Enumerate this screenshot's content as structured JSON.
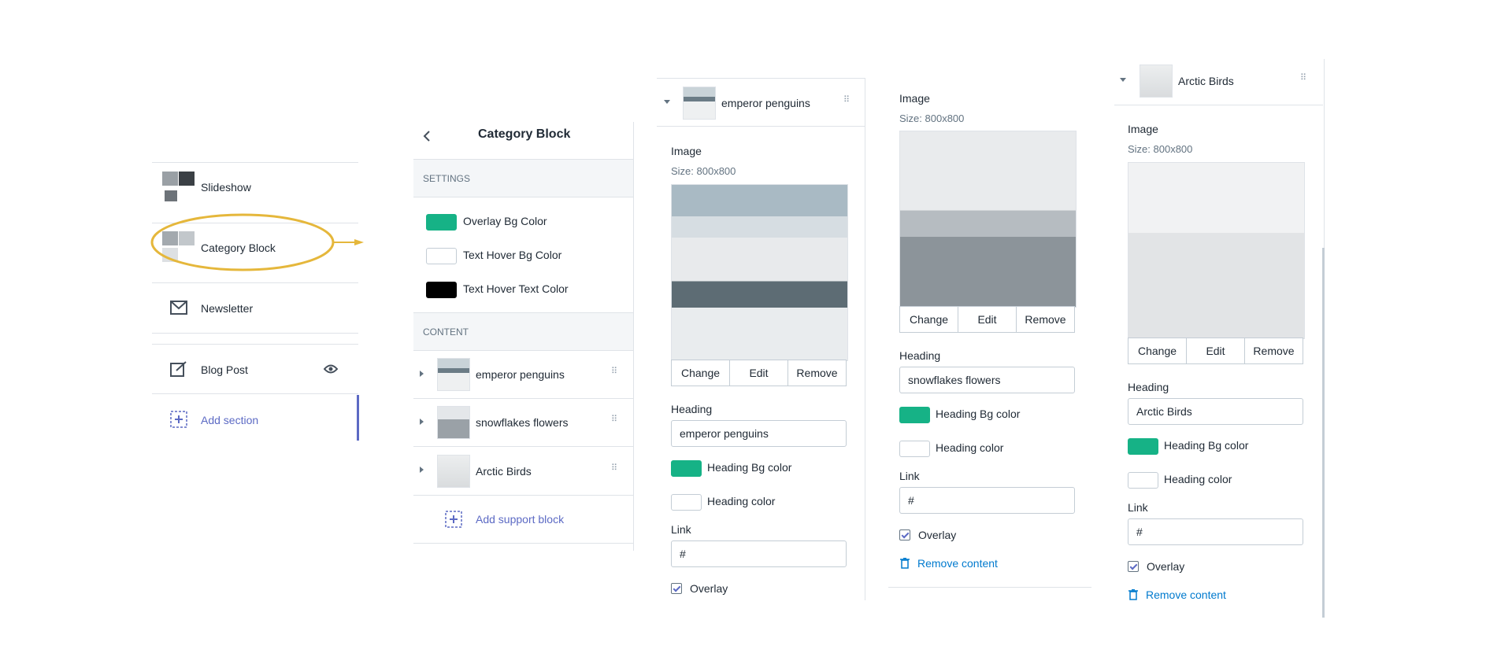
{
  "sections_panel": {
    "items": [
      {
        "label": "Slideshow",
        "icon": "slideshow-thumb-icon"
      },
      {
        "label": "Category Block",
        "icon": "category-thumb-icon"
      },
      {
        "label": "Newsletter",
        "icon": "envelope-icon"
      },
      {
        "label": "Blog Post",
        "icon": "edit-icon"
      }
    ],
    "add_section": "Add section",
    "highlight_color": "#e5b73b",
    "eye_icon": "eye-icon"
  },
  "category_panel": {
    "title": "Category Block",
    "back_icon": "chevron-left-icon",
    "settings_header": "SETTINGS",
    "colors": [
      {
        "label": "Overlay Bg Color",
        "color": "#16b286"
      },
      {
        "label": "Text Hover Bg Color",
        "color": "#ffffff"
      },
      {
        "label": "Text Hover Text Color",
        "color": "#000000"
      }
    ],
    "content_header": "CONTENT",
    "blocks": [
      {
        "label": "emperor penguins"
      },
      {
        "label": "snowflakes flowers"
      },
      {
        "label": "Arctic Birds"
      }
    ],
    "add_block": "Add support block"
  },
  "block1": {
    "title": "emperor penguins",
    "image_label": "Image",
    "size": "Size: 800x800",
    "buttons": [
      "Change",
      "Edit",
      "Remove"
    ],
    "heading_label": "Heading",
    "heading_value": "emperor penguins",
    "heading_bg_label": "Heading Bg color",
    "heading_bg_color": "#16b286",
    "heading_color_label": "Heading color",
    "link_label": "Link",
    "link_value": "#",
    "overlay_label": "Overlay"
  },
  "block2": {
    "image_label": "Image",
    "size": "Size: 800x800",
    "buttons": [
      "Change",
      "Edit",
      "Remove"
    ],
    "heading_label": "Heading",
    "heading_value": "snowflakes flowers",
    "heading_bg_label": "Heading Bg color",
    "heading_bg_color": "#16b286",
    "heading_color_label": "Heading color",
    "link_label": "Link",
    "link_value": "#",
    "overlay_label": "Overlay",
    "remove_content": "Remove content"
  },
  "block3": {
    "title": "Arctic Birds",
    "image_label": "Image",
    "size": "Size: 800x800",
    "buttons": [
      "Change",
      "Edit",
      "Remove"
    ],
    "heading_label": "Heading",
    "heading_value": "Arctic Birds",
    "heading_bg_label": "Heading Bg color",
    "heading_bg_color": "#16b286",
    "heading_color_label": "Heading color",
    "link_label": "Link",
    "link_value": "#",
    "overlay_label": "Overlay",
    "remove_content": "Remove content"
  }
}
